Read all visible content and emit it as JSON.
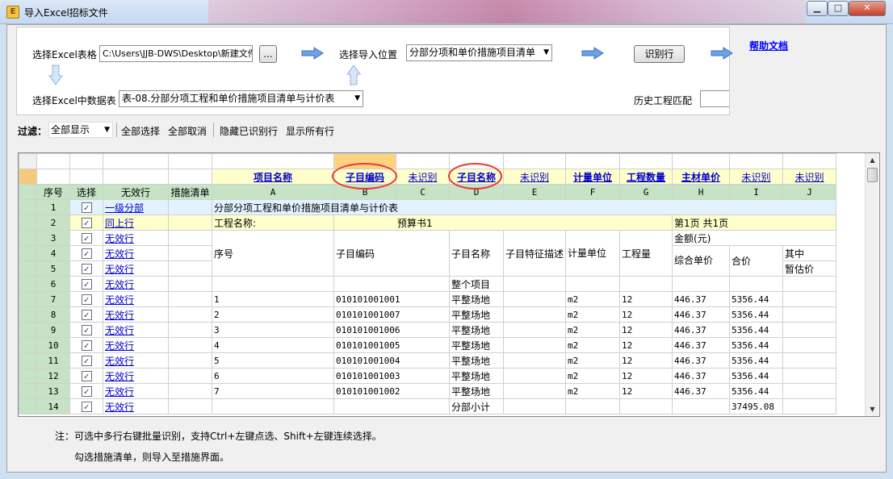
{
  "window": {
    "title": "导入Excel招标文件",
    "min_label": "▁",
    "max_label": "□",
    "close_label": "✕"
  },
  "top": {
    "select_excel_label": "选择Excel表格",
    "excel_path": "C:\\Users\\JJB-DWS\\Desktop\\新建文件",
    "browse_label": "...",
    "import_pos_label": "选择导入位置",
    "import_pos_value": "分部分项和单价措施项目清单",
    "recognize_label": "识别行",
    "help_label": "帮助文档",
    "select_sheet_label": "选择Excel中数据表",
    "sheet_value": "表-08.分部分项工程和单价措施项目清单与计价表",
    "history_label": "历史工程匹配"
  },
  "filter": {
    "label": "过滤：",
    "value": "全部显示",
    "select_all": "全部选择",
    "cancel_all": "全部取消",
    "hide_recognized": "隐藏已识别行",
    "show_all_rows": "显示所有行"
  },
  "grid": {
    "headers": [
      "序号",
      "选择",
      "无效行",
      "措施清单"
    ],
    "mappings": [
      "项目名称",
      "子目编码",
      "未识别",
      "子目名称",
      "未识别",
      "计量单位",
      "工程数量",
      "主材单价",
      "未识别",
      "未识别"
    ],
    "col_letters": [
      "A",
      "B",
      "C",
      "D",
      "E",
      "F",
      "G",
      "H",
      "I",
      "J"
    ],
    "rows": [
      {
        "no": "1",
        "type": "一级分部"
      },
      {
        "no": "2",
        "type": "同上行"
      },
      {
        "no": "3",
        "type": "无效行"
      },
      {
        "no": "4",
        "type": "无效行"
      },
      {
        "no": "5",
        "type": "无效行"
      },
      {
        "no": "6",
        "type": "无效行"
      },
      {
        "no": "7",
        "type": "无效行"
      },
      {
        "no": "8",
        "type": "无效行"
      },
      {
        "no": "9",
        "type": "无效行"
      },
      {
        "no": "10",
        "type": "无效行"
      },
      {
        "no": "11",
        "type": "无效行"
      },
      {
        "no": "12",
        "type": "无效行"
      },
      {
        "no": "13",
        "type": "无效行"
      },
      {
        "no": "14",
        "type": "无效行"
      }
    ],
    "r1_title": "分部分项工程和单价措施项目清单与计价表",
    "r2_project": "工程名称:",
    "r2_budget": "预算书1",
    "r2_page": "第1页 共1页",
    "h_seq": "序号",
    "h_code": "子目编码",
    "h_name": "子目名称",
    "h_desc": "子目特征描述",
    "h_unit": "计量单位",
    "h_qty": "工程量",
    "h_amount": "金额(元)",
    "h_unitprice": "综合单价",
    "h_total": "合价",
    "h_of": "其中",
    "h_provisional": "暂估价",
    "r6_name": "整个项目",
    "items": [
      {
        "seq": "1",
        "code": "010101001001",
        "name": "平整场地",
        "unit": "m2",
        "qty": "12",
        "price": "446.37",
        "total": "5356.44"
      },
      {
        "seq": "2",
        "code": "010101001007",
        "name": "平整场地",
        "unit": "m2",
        "qty": "12",
        "price": "446.37",
        "total": "5356.44"
      },
      {
        "seq": "3",
        "code": "010101001006",
        "name": "平整场地",
        "unit": "m2",
        "qty": "12",
        "price": "446.37",
        "total": "5356.44"
      },
      {
        "seq": "4",
        "code": "010101001005",
        "name": "平整场地",
        "unit": "m2",
        "qty": "12",
        "price": "446.37",
        "total": "5356.44"
      },
      {
        "seq": "5",
        "code": "010101001004",
        "name": "平整场地",
        "unit": "m2",
        "qty": "12",
        "price": "446.37",
        "total": "5356.44"
      },
      {
        "seq": "6",
        "code": "010101001003",
        "name": "平整场地",
        "unit": "m2",
        "qty": "12",
        "price": "446.37",
        "total": "5356.44"
      },
      {
        "seq": "7",
        "code": "010101001002",
        "name": "平整场地",
        "unit": "m2",
        "qty": "12",
        "price": "446.37",
        "total": "5356.44"
      }
    ],
    "r14_name": "分部小计",
    "r14_total": "37495.08",
    "check_mark": "✓"
  },
  "notes": {
    "line1": "注：可选中多行右键批量识别，支持Ctrl+左键点选、Shift+左键连续选择。",
    "line2": "勾选措施清单，则导入至措施界面。"
  }
}
